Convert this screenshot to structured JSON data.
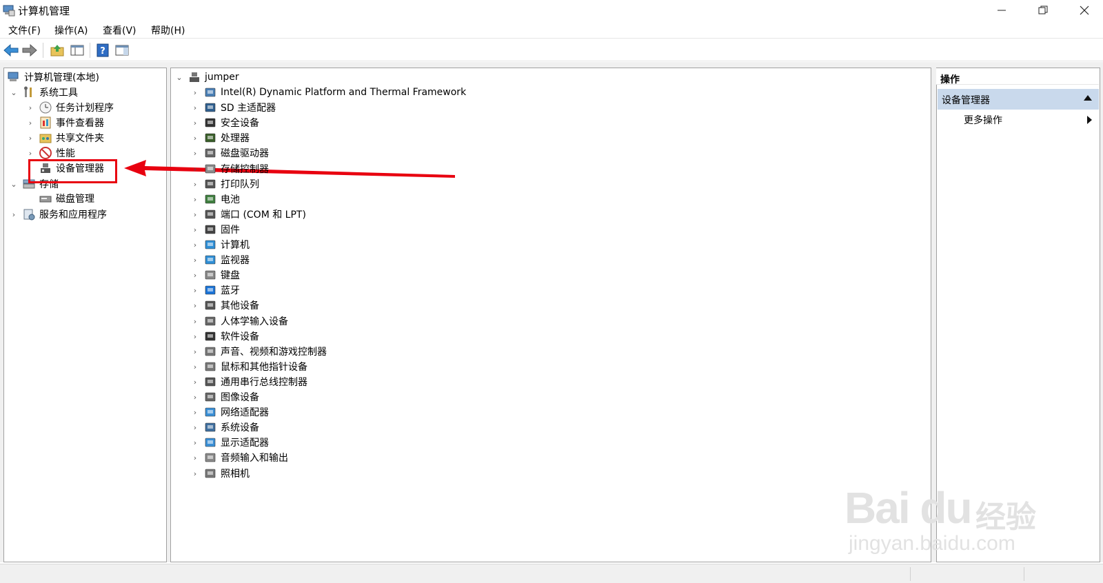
{
  "window": {
    "title": "计算机管理",
    "min_icon": "minimize-icon",
    "max_icon": "restore-icon",
    "close_icon": "close-icon"
  },
  "menu": [
    {
      "label": "文件(F)"
    },
    {
      "label": "操作(A)"
    },
    {
      "label": "查看(V)"
    },
    {
      "label": "帮助(H)"
    }
  ],
  "toolbar": {
    "buttons": [
      "back-arrow-icon",
      "forward-arrow-icon",
      "up-folder-icon",
      "show-hide-tree-icon",
      "help-icon",
      "show-hide-action-pane-icon"
    ]
  },
  "left_tree": {
    "root": "计算机管理(本地)",
    "system_tools": "系统工具",
    "task_scheduler": "任务计划程序",
    "event_viewer": "事件查看器",
    "shared_folders": "共享文件夹",
    "performance": "性能",
    "device_manager": "设备管理器",
    "storage": "存储",
    "disk_management": "磁盘管理",
    "services_apps": "服务和应用程序"
  },
  "center_tree": {
    "root": "jumper",
    "items": [
      {
        "label": "Intel(R) Dynamic Platform and Thermal Framework",
        "icon": "system-device-icon"
      },
      {
        "label": "SD 主适配器",
        "icon": "sd-adapter-icon"
      },
      {
        "label": "安全设备",
        "icon": "security-device-icon"
      },
      {
        "label": "处理器",
        "icon": "processor-icon"
      },
      {
        "label": "磁盘驱动器",
        "icon": "disk-drive-icon"
      },
      {
        "label": "存储控制器",
        "icon": "storage-controller-icon"
      },
      {
        "label": "打印队列",
        "icon": "printer-icon"
      },
      {
        "label": "电池",
        "icon": "battery-icon"
      },
      {
        "label": "端口 (COM 和 LPT)",
        "icon": "port-icon"
      },
      {
        "label": "固件",
        "icon": "firmware-icon"
      },
      {
        "label": "计算机",
        "icon": "computer-icon"
      },
      {
        "label": "监视器",
        "icon": "monitor-icon"
      },
      {
        "label": "键盘",
        "icon": "keyboard-icon"
      },
      {
        "label": "蓝牙",
        "icon": "bluetooth-icon"
      },
      {
        "label": "其他设备",
        "icon": "other-device-icon"
      },
      {
        "label": "人体学输入设备",
        "icon": "hid-icon"
      },
      {
        "label": "软件设备",
        "icon": "software-device-icon"
      },
      {
        "label": "声音、视频和游戏控制器",
        "icon": "sound-icon"
      },
      {
        "label": "鼠标和其他指针设备",
        "icon": "mouse-icon"
      },
      {
        "label": "通用串行总线控制器",
        "icon": "usb-icon"
      },
      {
        "label": "图像设备",
        "icon": "imaging-device-icon"
      },
      {
        "label": "网络适配器",
        "icon": "network-adapter-icon"
      },
      {
        "label": "系统设备",
        "icon": "system-device-icon"
      },
      {
        "label": "显示适配器",
        "icon": "display-adapter-icon"
      },
      {
        "label": "音频输入和输出",
        "icon": "audio-io-icon"
      },
      {
        "label": "照相机",
        "icon": "camera-icon"
      }
    ]
  },
  "actions": {
    "header": "操作",
    "section": "设备管理器",
    "more": "更多操作"
  },
  "watermark": {
    "brand": "Bai du",
    "cn": "经验",
    "url": "jingyan.baidu.com"
  },
  "colors": {
    "highlight": "#e8000f",
    "section_bg": "#c9d9ec"
  }
}
